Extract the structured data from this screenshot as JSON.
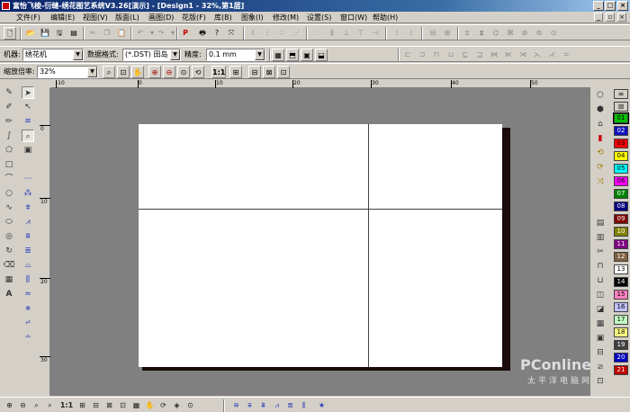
{
  "window": {
    "title": "富怡飞梭-衍缝-绣花图艺系统V3.26[演示] - [Design1 - 32%,第1层]",
    "controls": [
      "_",
      "□",
      "×"
    ],
    "mdi_controls": [
      "_",
      "▫",
      "×"
    ]
  },
  "menu": [
    "文件(F)",
    "编辑(E)",
    "视图(V)",
    "版面(L)",
    "画图(D)",
    "花版(F)",
    "库(B)",
    "图象(I)",
    "修改(M)",
    "设置(S)",
    "窗口(W)",
    "帮助(H)"
  ],
  "toolbar2": {
    "machine_label": "机器:",
    "machine_value": "绣花机",
    "format_label": "数据格式:",
    "format_value": "(*.DST) 田岛",
    "precision_label": "精度:",
    "precision_value": "0.1 mm",
    "zoom_label": "缩放倍率:",
    "zoom_value": "32%",
    "one_to_one": "1:1"
  },
  "rulers": {
    "h_labels": [
      "-10",
      "0",
      "10",
      "20",
      "30",
      "40",
      "50"
    ],
    "v_labels": [
      "0",
      "10",
      "20",
      "30"
    ]
  },
  "palette": {
    "labels": [
      "01",
      "02",
      "03",
      "04",
      "05",
      "06",
      "07",
      "08",
      "09",
      "10",
      "11",
      "12",
      "13",
      "14",
      "15",
      "16",
      "17",
      "18",
      "19",
      "20",
      "21"
    ],
    "colors": [
      "#00c000",
      "#1010c0",
      "#ff0000",
      "#ffff00",
      "#00ffff",
      "#ff00ff",
      "#008000",
      "#000080",
      "#800000",
      "#808000",
      "#800080",
      "#806040",
      "#ffffff",
      "#000000",
      "#ff80c0",
      "#c0c0ff",
      "#c0ffc0",
      "#ffff80",
      "#404040",
      "#0000c0",
      "#c00000"
    ]
  },
  "watermark": {
    "brand": "PConline",
    "sub": "太平洋电脑网"
  },
  "bottombar": {
    "one_to_one": "1:1"
  }
}
